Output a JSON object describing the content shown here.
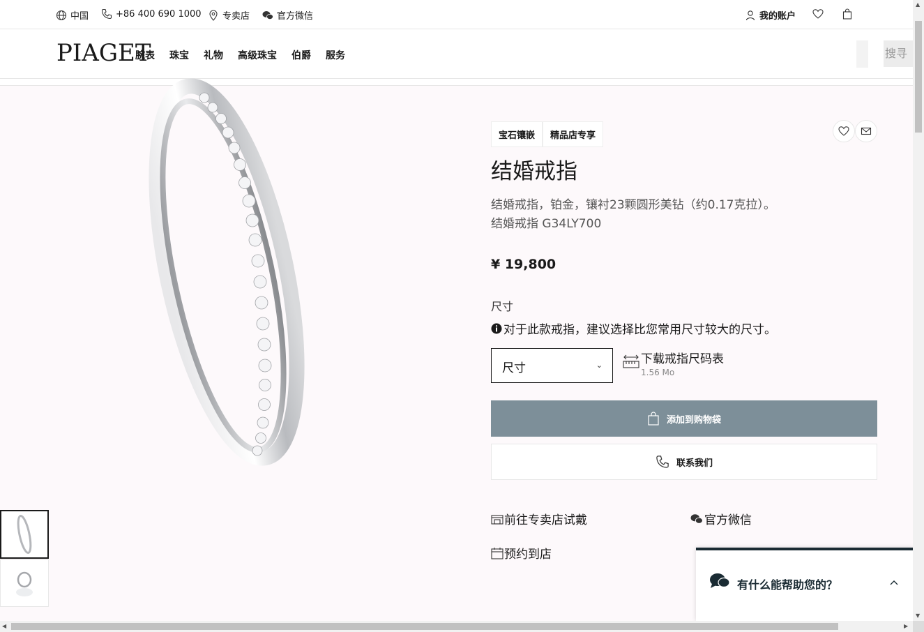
{
  "topbar": {
    "region": "中国",
    "phone": "+86 400 690 1000",
    "stores": "专卖店",
    "wechat": "官方微信",
    "account": "我的账户",
    "icons": [
      "globe-icon",
      "phone-icon",
      "location-pin-icon",
      "wechat-icon",
      "user-icon",
      "heart-icon",
      "shopping-bag-icon"
    ]
  },
  "header": {
    "logo": "PIAGET",
    "nav": [
      "腕表",
      "珠宝",
      "礼物",
      "高级珠宝",
      "伯爵",
      "服务"
    ],
    "search_label": "搜寻"
  },
  "product": {
    "tags": [
      "宝石镶嵌",
      "精品店专享"
    ],
    "title": "结婚戒指",
    "description": "结婚戒指，铂金，镶衬23颗圆形美钻（约0.17克拉）。",
    "reference": "结婚戒指 G34LY700",
    "price": "¥ 19,800",
    "size_label": "尺寸",
    "size_note": "对于此款戒指，建议选择比您常用尺寸较大的尺寸。",
    "size_select": "尺寸",
    "download_label": "下载戒指尺码表",
    "download_size": "1.56 Mo",
    "add_to_bag": "添加到购物袋",
    "contact": "联系我们",
    "try_in_store": "前往专卖店试戴",
    "wechat": "官方微信",
    "book_appointment": "预约到店"
  },
  "chat": {
    "label": "有什么能帮助您的？"
  },
  "colors": {
    "add_button": "#7d8f99",
    "chat_accent": "#1a2b33",
    "page_bg": "#fdf9fb"
  }
}
